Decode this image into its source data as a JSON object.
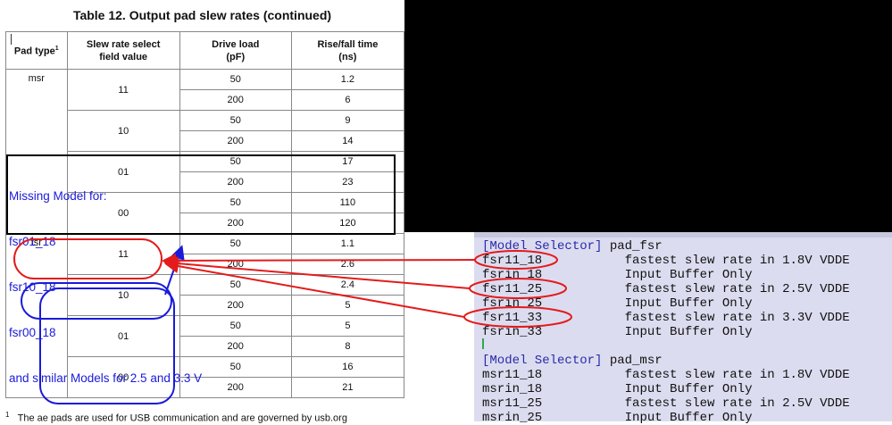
{
  "table": {
    "title": "Table 12. Output pad slew rates (continued)",
    "headers": {
      "pad_type": "Pad type",
      "pad_type_sup": "1",
      "field_l1": "Slew rate select",
      "field_l2": "field value",
      "load_l1": "Drive load",
      "load_l2": "(pF)",
      "rise_l1": "Rise/fall time",
      "rise_l2": "(ns)"
    },
    "groups": [
      {
        "pad": "msr",
        "field": "11",
        "rows": [
          {
            "load": "50",
            "time": "1.2"
          },
          {
            "load": "200",
            "time": "6"
          }
        ]
      },
      {
        "pad": "",
        "field": "10",
        "rows": [
          {
            "load": "50",
            "time": "9"
          },
          {
            "load": "200",
            "time": "14"
          }
        ]
      },
      {
        "pad": "",
        "field": "01",
        "rows": [
          {
            "load": "50",
            "time": "17"
          },
          {
            "load": "200",
            "time": "23"
          }
        ]
      },
      {
        "pad": "",
        "field": "00",
        "rows": [
          {
            "load": "50",
            "time": "110"
          },
          {
            "load": "200",
            "time": "120"
          }
        ]
      },
      {
        "pad": "fsr",
        "field": "11",
        "rows": [
          {
            "load": "50",
            "time": "1.1"
          },
          {
            "load": "200",
            "time": "2.6"
          }
        ]
      },
      {
        "pad": "",
        "field": "10",
        "rows": [
          {
            "load": "50",
            "time": "2.4"
          },
          {
            "load": "200",
            "time": "5"
          }
        ]
      },
      {
        "pad": "",
        "field": "01",
        "rows": [
          {
            "load": "50",
            "time": "5"
          },
          {
            "load": "200",
            "time": "8"
          }
        ]
      },
      {
        "pad": "",
        "field": "00",
        "rows": [
          {
            "load": "50",
            "time": "16"
          },
          {
            "load": "200",
            "time": "21"
          }
        ]
      }
    ],
    "footnote_sup": "1",
    "footnote": "The ae pads are used for USB communication and are governed by usb.org"
  },
  "annotation": {
    "lines": [
      "Missing Model for:",
      "fsr01_18",
      "fsr10_18",
      "fsr00_18",
      "and similar Models for 2.5 and 3.3 V"
    ],
    "colors": {
      "blue": "#1a1ad9",
      "red": "#e31b1b",
      "black": "#000000"
    }
  },
  "code": {
    "lines": [
      {
        "selector": "[Model Selector]",
        "value": "pad_fsr"
      },
      {
        "name": "fsr11_18",
        "desc": "fastest slew rate in 1.8V VDDE"
      },
      {
        "name": "fsrin_18",
        "desc": "Input Buffer Only"
      },
      {
        "name": "fsr11_25",
        "desc": "fastest slew rate in 2.5V VDDE"
      },
      {
        "name": "fsrin_25",
        "desc": "Input Buffer Only"
      },
      {
        "name": "fsr11_33",
        "desc": "fastest slew rate in 3.3V VDDE"
      },
      {
        "name": "fsrin_33",
        "desc": "Input Buffer Only"
      },
      {
        "selector": "[Model Selector]",
        "value": "pad_msr"
      },
      {
        "name": "msr11_18",
        "desc": "fastest slew rate in 1.8V VDDE"
      },
      {
        "name": "msrin_18",
        "desc": "Input Buffer Only"
      },
      {
        "name": "msr11_25",
        "desc": "fastest slew rate in 2.5V VDDE"
      },
      {
        "name": "msrin_25",
        "desc": "Input Buffer Only"
      }
    ]
  }
}
